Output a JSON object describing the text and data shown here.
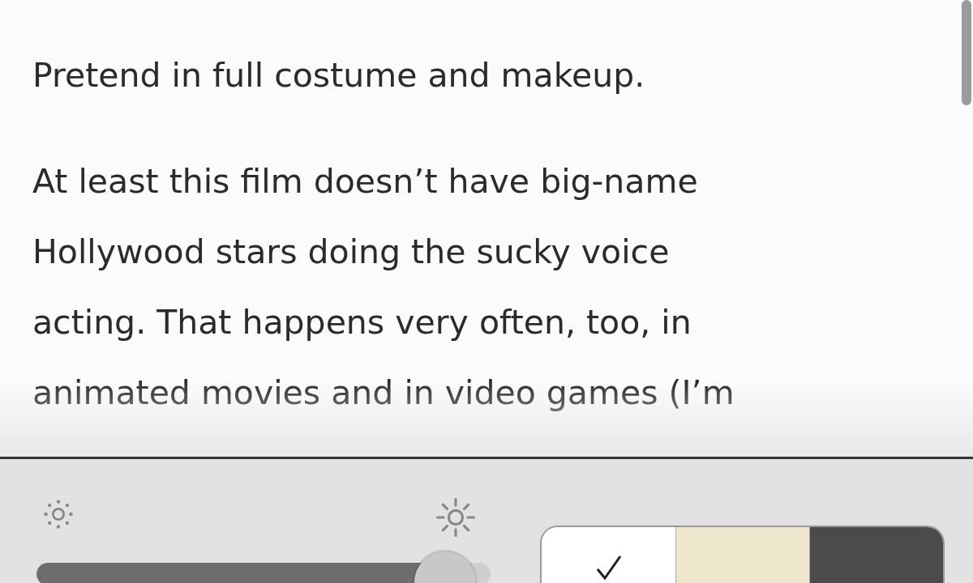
{
  "article": {
    "paragraphs": [
      [
        "Pretend in full costume and makeup."
      ],
      [
        "At least this film doesn’t have big-name",
        "Hollywood stars doing the sucky voice",
        "acting. That happens very often, too, in",
        "animated movies and in video games (I’m"
      ]
    ]
  },
  "display_panel": {
    "brightness": {
      "level": 0.9
    },
    "themes": [
      {
        "color": "#ffffff",
        "selected": true
      },
      {
        "color": "#ede6cc",
        "selected": false
      },
      {
        "color": "#4b4b4b",
        "selected": false
      }
    ]
  }
}
